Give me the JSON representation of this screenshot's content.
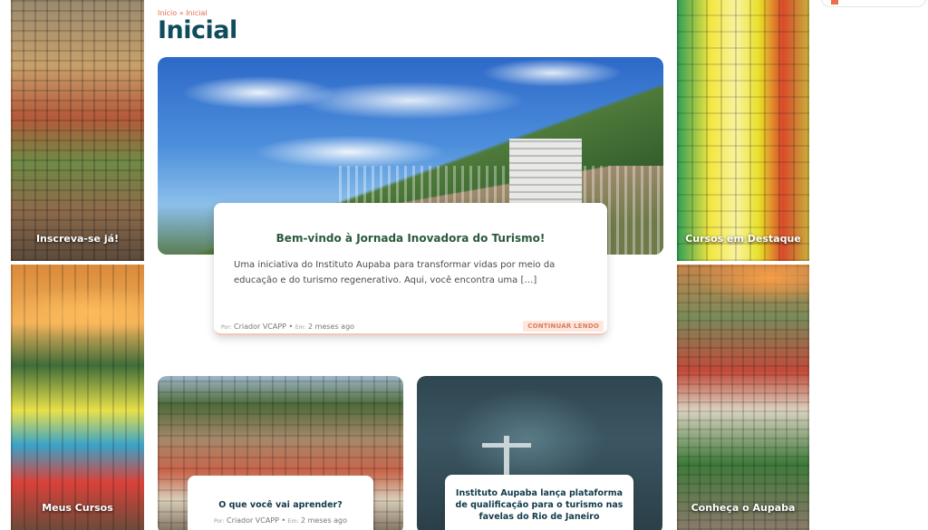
{
  "breadcrumb": {
    "home": "Início",
    "separator": "»",
    "current": "Inicial"
  },
  "page_title": "Inicial",
  "tiles": {
    "left_top": "Inscreva-se já!",
    "left_bottom": "Meus Cursos",
    "right_top": "Cursos em Destaque",
    "right_bottom": "Conheça o Aupaba"
  },
  "hero": {
    "title": "Bem-vindo à Jornada Inovadora do Turismo!",
    "excerpt": "Uma iniciativa do Instituto Aupaba para transformar vidas por meio da educação e do turismo regenerativo. Aqui, você encontra uma […]",
    "author_prefix": "Por:",
    "author": "Criador VCAPP",
    "separator": "•",
    "date_prefix": "Em:",
    "date": "2 meses ago",
    "read_more": "CONTINUAR LENDO"
  },
  "cards": [
    {
      "title": "O que você vai aprender?",
      "author_prefix": "Por:",
      "author": "Criador VCAPP",
      "separator": "•",
      "date_prefix": "Em:",
      "date": "2 meses ago"
    },
    {
      "title": "Instituto Aupaba lança plataforma de qualificação para o turismo nas favelas do Rio de Janeiro"
    }
  ],
  "colors": {
    "title": "#0f4c5c",
    "accent": "#e46a4a",
    "hero_heading": "#2a5a3a"
  }
}
